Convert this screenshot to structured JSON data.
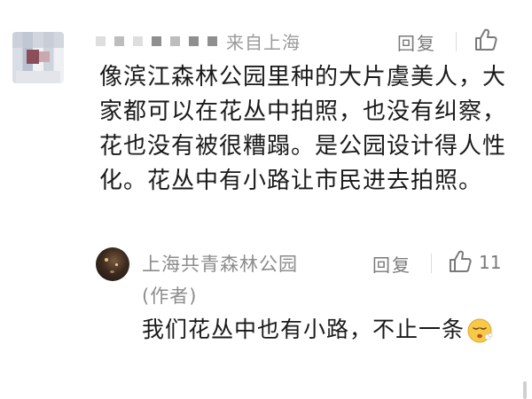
{
  "main_comment": {
    "author_name": "",
    "location": "来自上海",
    "reply_label": "回复",
    "body": "像滨江森林公园里种的大片虞美人，大家都可以在花丛中拍照，也没有纠察，花也没有被很糟蹋。是公园设计得人性化。花丛中有小路让市民进去拍照。"
  },
  "author_reply": {
    "author_name": "上海共青森林公园",
    "author_tag": "(作者)",
    "reply_label": "回复",
    "like_count": "11",
    "body": "我们花丛中也有小路，不止一条",
    "emoji": "relieved-face"
  },
  "icons": {
    "like": "thumbs-up-icon"
  },
  "colors": {
    "text_primary": "#1a1a1a",
    "text_secondary": "#8c8c8c",
    "divider": "#dcdcdc"
  }
}
